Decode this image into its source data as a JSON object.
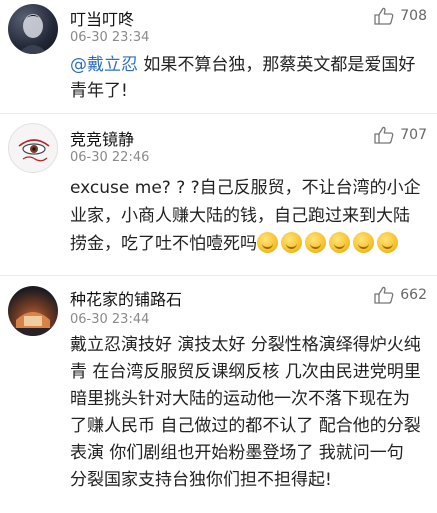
{
  "comments": [
    {
      "username": "叮当叮咚",
      "time": "06-30 23:34",
      "likes": "708",
      "mention": "@戴立忍",
      "text": " 如果不算台独，那蔡英文都是爱国好青年了!"
    },
    {
      "username": "竞竞镜静",
      "time": "06-30 22:46",
      "likes": "707",
      "text": "excuse me? ? ?自己反服贸，不让台湾的小企业家，小商人赚大陆的钱，自己跑过来到大陆捞金，吃了吐不怕噎死吗",
      "emoji_count": 6,
      "emoji_icon": "grinning-emoji-icon"
    },
    {
      "username": "种花家的铺路石",
      "time": "06-30 23:44",
      "likes": "662",
      "text": "戴立忍演技好 演技太好 分裂性格演绎得炉火纯青 在台湾反服贸反课纲反核 几次由民进党明里暗里挑头针对大陆的运动他一次不落下现在为了赚人民币 自己做过的都不认了 配合他的分裂表演 你们剧组也开始粉墨登场了 我就问一句 分裂国家支持台独你们担不担得起!"
    }
  ],
  "colors": {
    "mention": "#2f6fbf",
    "meta": "#8a8a8a",
    "divider": "#ececec"
  }
}
